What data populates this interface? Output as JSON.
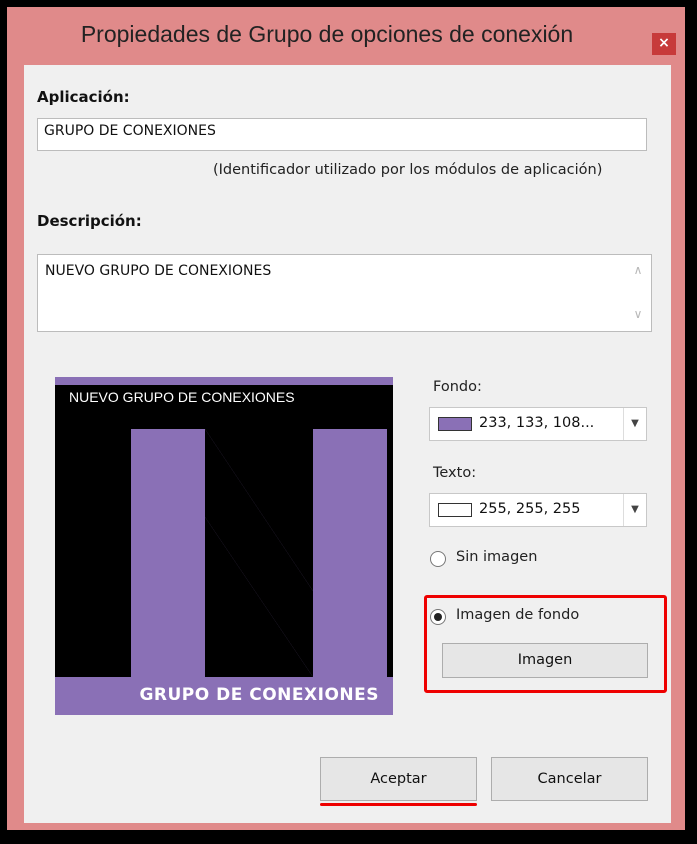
{
  "window": {
    "title": "Propiedades de Grupo de opciones de conexión",
    "close_glyph": "×"
  },
  "app": {
    "label": "Aplicación:",
    "value": "GRUPO DE CONEXIONES",
    "hint": "(Identificador utilizado por los módulos de aplicación)"
  },
  "description": {
    "label": "Descripción:",
    "value": "NUEVO GRUPO DE CONEXIONES"
  },
  "preview": {
    "title": "NUEVO GRUPO DE CONEXIONES",
    "footer": "GRUPO DE CONEXIONES",
    "background_color": "#8a70b6"
  },
  "fondo": {
    "label": "Fondo:",
    "value": "233, 133, 108...",
    "swatch_color": "#8a70b6"
  },
  "texto": {
    "label": "Texto:",
    "value": "255, 255, 255",
    "swatch_color": "#ffffff"
  },
  "image_options": {
    "none_label": "Sin imagen",
    "background_label": "Imagen de fondo",
    "selected": "Imagen de fondo",
    "button_label": "Imagen"
  },
  "buttons": {
    "accept": "Aceptar",
    "cancel": "Cancelar"
  },
  "colors": {
    "titlebar": "#e08a8a",
    "highlight": "#ee0000",
    "accent_purple": "#8a70b6"
  }
}
